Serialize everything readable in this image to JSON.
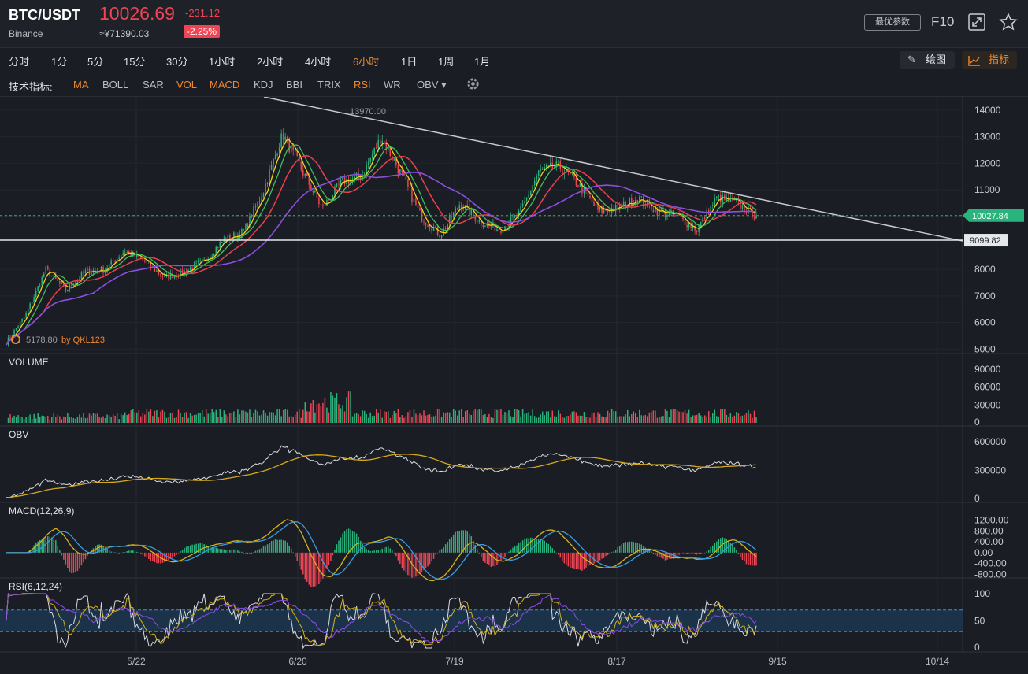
{
  "header": {
    "symbol": "BTC/USDT",
    "exchange": "Binance",
    "price": "10026.69",
    "cny": "≈¥71390.03",
    "change": "-231.12",
    "change_pct": "-2.25%",
    "params_button": "最优参数",
    "f10": "F10",
    "expand_icon": "expand-icon",
    "star_icon": "star-icon"
  },
  "timeframes": [
    "分时",
    "1分",
    "5分",
    "15分",
    "30分",
    "1小时",
    "2小时",
    "4小时",
    "6小时",
    "1日",
    "1周",
    "1月"
  ],
  "active_timeframe": "6小时",
  "tools": {
    "draw": "绘图",
    "indicator": "指标"
  },
  "indicators_label": "技术指标:",
  "indicators": [
    {
      "name": "MA",
      "on": true
    },
    {
      "name": "BOLL",
      "on": false
    },
    {
      "name": "SAR",
      "on": false
    },
    {
      "name": "VOL",
      "on": true
    },
    {
      "name": "MACD",
      "on": true
    },
    {
      "name": "KDJ",
      "on": false
    },
    {
      "name": "BBI",
      "on": false
    },
    {
      "name": "TRIX",
      "on": false
    },
    {
      "name": "RSI",
      "on": true
    },
    {
      "name": "WR",
      "on": false
    },
    {
      "name": "OBV",
      "on": false,
      "dropdown": true
    }
  ],
  "colors": {
    "up": "#2bb37e",
    "down": "#ee4454",
    "accent": "#f0882e",
    "ma_yellow": "#f5d218",
    "ma_green": "#3fbf5c",
    "ma_red": "#e8414d",
    "ma_purple": "#8a4fe0"
  },
  "chart_data": {
    "type": "candlestick",
    "x_tick_labels": [
      "5/22",
      "6/20",
      "7/19",
      "8/17",
      "9/15",
      "10/14"
    ],
    "main": {
      "ylim": [
        4800,
        14500
      ],
      "y_ticks": [
        "14000",
        "13000",
        "12000",
        "11000",
        "10000",
        "9000",
        "8000",
        "7000",
        "6000",
        "5000"
      ],
      "high_annotation": "13970.00",
      "low_annotation": "5178.80",
      "last_price_tag": "10027.84",
      "support_line_tag": "9099.82",
      "watermark": "by QKL123",
      "close_approx": [
        {
          "date": "5/06",
          "close": 5250
        },
        {
          "date": "5/12",
          "close": 6300
        },
        {
          "date": "5/15",
          "close": 8000
        },
        {
          "date": "5/18",
          "close": 7200
        },
        {
          "date": "5/22",
          "close": 7900
        },
        {
          "date": "5/26",
          "close": 8000
        },
        {
          "date": "5/30",
          "close": 8700
        },
        {
          "date": "6/03",
          "close": 8300
        },
        {
          "date": "6/06",
          "close": 7700
        },
        {
          "date": "6/10",
          "close": 7900
        },
        {
          "date": "6/14",
          "close": 8300
        },
        {
          "date": "6/18",
          "close": 9100
        },
        {
          "date": "6/20",
          "close": 9400
        },
        {
          "date": "6/23",
          "close": 10900
        },
        {
          "date": "6/26",
          "close": 13100
        },
        {
          "date": "6/29",
          "close": 11700
        },
        {
          "date": "7/02",
          "close": 10300
        },
        {
          "date": "7/05",
          "close": 11300
        },
        {
          "date": "7/08",
          "close": 11500
        },
        {
          "date": "7/10",
          "close": 13000
        },
        {
          "date": "7/13",
          "close": 11600
        },
        {
          "date": "7/16",
          "close": 10000
        },
        {
          "date": "7/19",
          "close": 9300
        },
        {
          "date": "7/22",
          "close": 10500
        },
        {
          "date": "7/25",
          "close": 9800
        },
        {
          "date": "7/29",
          "close": 9500
        },
        {
          "date": "8/02",
          "close": 10100
        },
        {
          "date": "8/06",
          "close": 11700
        },
        {
          "date": "8/09",
          "close": 11900
        },
        {
          "date": "8/12",
          "close": 11200
        },
        {
          "date": "8/15",
          "close": 10200
        },
        {
          "date": "8/17",
          "close": 10300
        },
        {
          "date": "8/20",
          "close": 10700
        },
        {
          "date": "8/24",
          "close": 10200
        },
        {
          "date": "8/28",
          "close": 10000
        },
        {
          "date": "8/30",
          "close": 9500
        },
        {
          "date": "9/03",
          "close": 10700
        },
        {
          "date": "9/06",
          "close": 10500
        },
        {
          "date": "9/09",
          "close": 10026
        }
      ]
    },
    "panels": [
      {
        "title": "VOLUME",
        "y_ticks": [
          "90000",
          "60000",
          "30000",
          "0"
        ]
      },
      {
        "title": "OBV",
        "y_ticks": [
          "600000",
          "300000",
          "0"
        ]
      },
      {
        "title": "MACD(12,26,9)",
        "y_ticks": [
          "1200.00",
          "800.00",
          "400.00",
          "0.00",
          "-400.00",
          "-800.00"
        ]
      },
      {
        "title": "RSI(6,12,24)",
        "y_ticks": [
          "100",
          "50",
          "0"
        ]
      }
    ]
  }
}
